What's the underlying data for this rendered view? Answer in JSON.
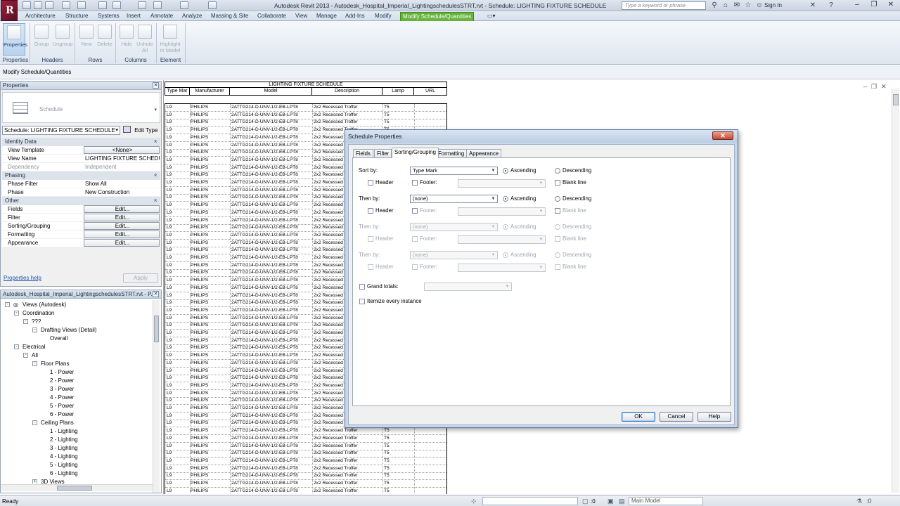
{
  "window": {
    "title": "Autodesk Revit 2013 -    Autodesk_Hospital_Imperial_LightingschedulesSTRT.rvt - Schedule: LIGHTING FIXTURE SCHEDULE",
    "search_placeholder": "Type a keyword or phrase",
    "signin": "Sign In"
  },
  "ribbon_tabs": [
    "Architecture",
    "Structure",
    "Systems",
    "Insert",
    "Annotate",
    "Analyze",
    "Massing & Site",
    "Collaborate",
    "View",
    "Manage",
    "Add-Ins",
    "Modify",
    "Modify Schedule/Quantities"
  ],
  "active_tab": "Modify Schedule/Quantities",
  "ribbon": {
    "buttons": [
      {
        "label": "Properties",
        "enabled": true
      },
      {
        "label": "Group",
        "enabled": false
      },
      {
        "label": "Ungroup",
        "enabled": false
      },
      {
        "label": "New",
        "enabled": false
      },
      {
        "label": "Delete",
        "enabled": false
      },
      {
        "label": "Hide",
        "enabled": false
      },
      {
        "label": "Unhide All",
        "enabled": false
      },
      {
        "label": "Highlight in Model",
        "enabled": false
      }
    ],
    "panels": [
      "Properties",
      "Headers",
      "Rows",
      "Columns",
      "Element"
    ]
  },
  "context_bar": "Modify Schedule/Quantities",
  "properties": {
    "title": "Properties",
    "type_name": "Schedule",
    "instance_selector": "Schedule: LIGHTING FIXTURE SCHEDULE",
    "edit_type": "Edit Type",
    "groups": [
      {
        "name": "Identity Data",
        "rows": [
          {
            "key": "View Template",
            "value": "<None>",
            "button": true,
            "dim": false
          },
          {
            "key": "View Name",
            "value": "LIGHTING FIXTURE SCHEDU...",
            "button": false,
            "dim": false
          },
          {
            "key": "Dependency",
            "value": "Independent",
            "button": false,
            "dim": true
          }
        ]
      },
      {
        "name": "Phasing",
        "rows": [
          {
            "key": "Phase Filter",
            "value": "Show All",
            "button": false,
            "dim": false
          },
          {
            "key": "Phase",
            "value": "New Construction",
            "button": false,
            "dim": false
          }
        ]
      },
      {
        "name": "Other",
        "rows": [
          {
            "key": "Fields",
            "value": "Edit...",
            "button": true,
            "dim": false
          },
          {
            "key": "Filter",
            "value": "Edit...",
            "button": true,
            "dim": false
          },
          {
            "key": "Sorting/Grouping",
            "value": "Edit...",
            "button": true,
            "dim": false
          },
          {
            "key": "Formatting",
            "value": "Edit...",
            "button": true,
            "dim": false
          },
          {
            "key": "Appearance",
            "value": "Edit...",
            "button": true,
            "dim": false
          }
        ]
      }
    ],
    "help_link": "Properties help",
    "apply": "Apply"
  },
  "browser": {
    "title": "Autodesk_Hospital_Imperial_LightingschedulesSTRT.rvt - P...",
    "nodes": [
      {
        "label": "Views (Autodesk)",
        "level": 0,
        "toggle": "-"
      },
      {
        "label": "Coordination",
        "level": 1,
        "toggle": "-"
      },
      {
        "label": "???",
        "level": 2,
        "toggle": "-"
      },
      {
        "label": "Drafting Views (Detail)",
        "level": 3,
        "toggle": "-"
      },
      {
        "label": "Overall",
        "level": 4,
        "toggle": ""
      },
      {
        "label": "Electrical",
        "level": 1,
        "toggle": "-"
      },
      {
        "label": "All",
        "level": 2,
        "toggle": "-"
      },
      {
        "label": "Floor Plans",
        "level": 3,
        "toggle": "-"
      },
      {
        "label": "1 - Power",
        "level": 4,
        "toggle": ""
      },
      {
        "label": "2 - Power",
        "level": 4,
        "toggle": ""
      },
      {
        "label": "3 - Power",
        "level": 4,
        "toggle": ""
      },
      {
        "label": "4 - Power",
        "level": 4,
        "toggle": ""
      },
      {
        "label": "5 - Power",
        "level": 4,
        "toggle": ""
      },
      {
        "label": "6 - Power",
        "level": 4,
        "toggle": ""
      },
      {
        "label": "Ceiling Plans",
        "level": 3,
        "toggle": "-"
      },
      {
        "label": "1 - Lighting",
        "level": 4,
        "toggle": ""
      },
      {
        "label": "2 - Lighting",
        "level": 4,
        "toggle": ""
      },
      {
        "label": "3 - Lighting",
        "level": 4,
        "toggle": ""
      },
      {
        "label": "4 - Lighting",
        "level": 4,
        "toggle": ""
      },
      {
        "label": "5 - Lighting",
        "level": 4,
        "toggle": ""
      },
      {
        "label": "6 - Lighting",
        "level": 4,
        "toggle": ""
      },
      {
        "label": "3D Views",
        "level": 3,
        "toggle": "+"
      }
    ]
  },
  "schedule": {
    "title": "LIGHTING FIXTURE SCHEDULE",
    "columns": [
      "Type Mar",
      "Manufacturer",
      "Model",
      "Description",
      "Lamp",
      "URL"
    ],
    "row": {
      "type_mark": "L9",
      "manufacturer": "PHILIPS",
      "model": "2ATTG214-D-UNV-1/2-EB-LPT8",
      "description": "2x2 Recessed Troffer",
      "lamp": "T5",
      "url": ""
    },
    "row_count": 52
  },
  "dialog": {
    "title": "Schedule Properties",
    "tabs": [
      "Fields",
      "Filter",
      "Sorting/Grouping",
      "Formatting",
      "Appearance"
    ],
    "active_tab": "Sorting/Grouping",
    "sort_levels": [
      {
        "label": "Sort by:",
        "value": "Type Mark",
        "ascending": "Ascending",
        "descending": "Descending",
        "header": "Header",
        "footer": "Footer:",
        "blank_line": "Blank line",
        "enabled": true
      },
      {
        "label": "Then by:",
        "value": "(none)",
        "ascending": "Ascending",
        "descending": "Descending",
        "header": "Header",
        "footer": "Footer:",
        "blank_line": "Blank line",
        "enabled": true
      },
      {
        "label": "Then by:",
        "value": "(none)",
        "ascending": "Ascending",
        "descending": "Descending",
        "header": "Header",
        "footer": "Footer:",
        "blank_line": "Blank line",
        "enabled": false
      },
      {
        "label": "Then by:",
        "value": "(none)",
        "ascending": "Ascending",
        "descending": "Descending",
        "header": "Header",
        "footer": "Footer:",
        "blank_line": "Blank line",
        "enabled": false
      }
    ],
    "grand_totals": "Grand totals:",
    "itemize": "Itemize every instance",
    "buttons": {
      "ok": "OK",
      "cancel": "Cancel",
      "help": "Help"
    }
  },
  "status": {
    "text": "Ready",
    "zero": ":0",
    "model": "Main Model"
  },
  "colors": {
    "active_tab": "#67b33d",
    "title_bar": "#c9d3df",
    "dialog_frame": "#c7d6e8",
    "link": "#1a55b0"
  }
}
